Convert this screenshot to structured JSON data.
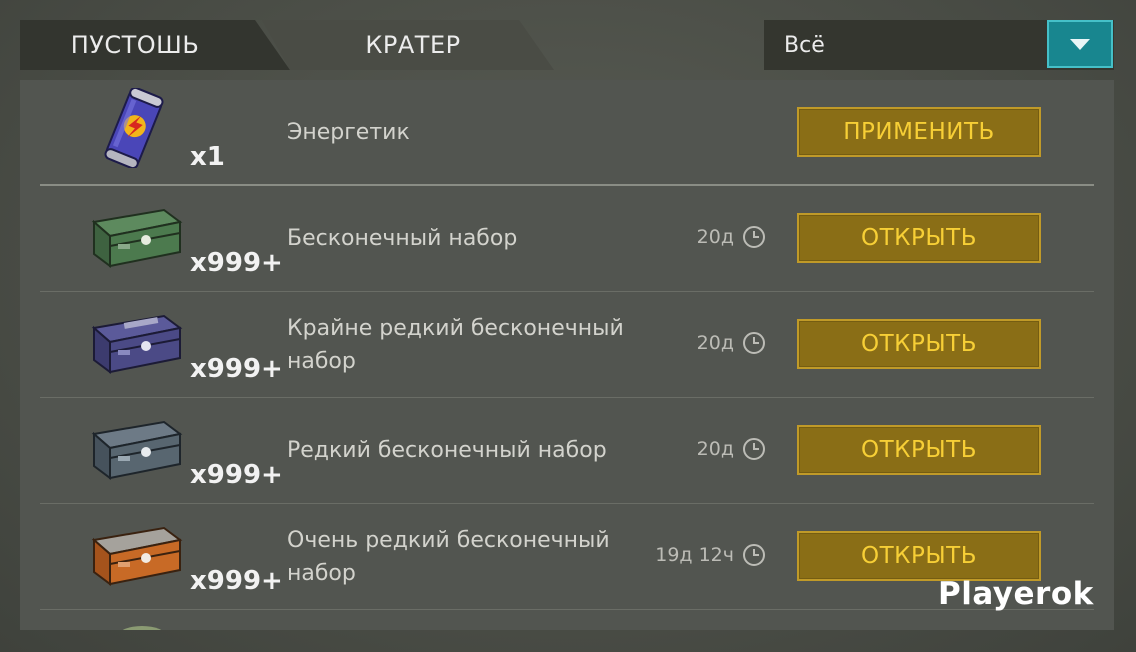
{
  "tabs": [
    {
      "label": "ПУСТОШЬ",
      "active": true
    },
    {
      "label": "КРАТЕР",
      "active": false
    }
  ],
  "filter": {
    "selected": "Всё"
  },
  "items": [
    {
      "icon": "energy-drink-icon",
      "quantity": "x1",
      "name": "Энергетик",
      "timer": "",
      "action": "ПРИМЕНИТЬ"
    },
    {
      "icon": "green-crate-icon",
      "quantity": "x999+",
      "name": "Бесконечный набор",
      "timer": "20д",
      "action": "ОТКРЫТЬ"
    },
    {
      "icon": "purple-crate-icon",
      "quantity": "x999+",
      "name": "Крайне редкий бесконечный набор",
      "timer": "20д",
      "action": "ОТКРЫТЬ"
    },
    {
      "icon": "blue-crate-icon",
      "quantity": "x999+",
      "name": "Редкий бесконечный набор",
      "timer": "20д",
      "action": "ОТКРЫТЬ"
    },
    {
      "icon": "orange-crate-icon",
      "quantity": "x999+",
      "name": "Очень редкий бесконечный набор",
      "timer": "19д 12ч",
      "action": "ОТКРЫТЬ"
    }
  ],
  "watermark": "Playerok",
  "colors": {
    "accent_teal": "#18868f",
    "button_gold": "#8a6e16",
    "button_text": "#f7cf36",
    "panel_bg": "#525550"
  }
}
